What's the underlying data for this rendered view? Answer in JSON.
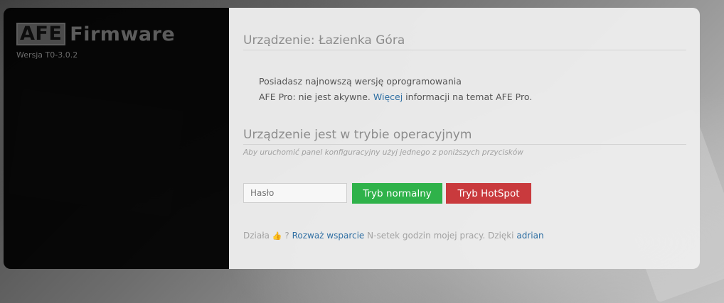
{
  "sidebar": {
    "logo_badge": "AFE",
    "logo_text": "Firmware",
    "version": "Wersja T0-3.0.2"
  },
  "device": {
    "title": "Urządzenie: Łazienka Góra",
    "line1": "Posiadasz najnowszą wersję oprogramowania",
    "line2_prefix": "AFE Pro: nie jest akywne.",
    "line2_link": "Więcej",
    "line2_suffix": "informacji na temat AFE Pro."
  },
  "mode": {
    "title": "Urządzenie jest w trybie operacyjnym",
    "subtitle": "Aby uruchomić panel konfiguracyjny użyj jednego z poniższych przycisków",
    "password_placeholder": "Hasło",
    "normal_button": "Tryb normalny",
    "hotspot_button": "Tryb HotSpot"
  },
  "footer": {
    "prefix": "Działa",
    "question": "?",
    "support_link": "Rozważ wsparcie",
    "middle": "N-setek godzin mojej pracy. Dzięki",
    "author_link": "adrian"
  },
  "colors": {
    "accent_link": "#2f6fa3",
    "button_green": "#2fb24a",
    "button_red": "#c93a3d"
  },
  "icons": {
    "thumb": "thumbs-up-icon"
  }
}
